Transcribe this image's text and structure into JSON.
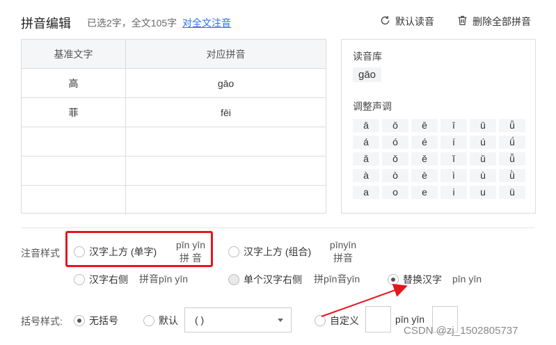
{
  "header": {
    "title": "拼音编辑",
    "selection_info": "已选2字，全文105字",
    "annotate_all_link": "对全文注音",
    "default_reading_button": "默认读音",
    "delete_all_button": "删除全部拼音"
  },
  "table": {
    "columns": [
      "基准文字",
      "对应拼音"
    ],
    "rows": [
      {
        "char": "高",
        "pinyin": "gāo"
      },
      {
        "char": "菲",
        "pinyin": "fēi"
      },
      {
        "char": "",
        "pinyin": ""
      },
      {
        "char": "",
        "pinyin": ""
      },
      {
        "char": "",
        "pinyin": ""
      }
    ]
  },
  "panel": {
    "library_label": "读音库",
    "library_item": "gāo",
    "tone_label": "调整声调",
    "tones": [
      [
        "ā",
        "ō",
        "ē",
        "ī",
        "ū",
        "ǖ"
      ],
      [
        "á",
        "ó",
        "é",
        "í",
        "ú",
        "ǘ"
      ],
      [
        "ǎ",
        "ǒ",
        "ě",
        "ǐ",
        "ǔ",
        "ǚ"
      ],
      [
        "à",
        "ò",
        "è",
        "ì",
        "ù",
        "ǜ"
      ],
      [
        "a",
        "o",
        "e",
        "i",
        "u",
        "ü"
      ]
    ]
  },
  "annotation_style": {
    "label": "注音样式",
    "options": [
      {
        "label": "汉字上方 (单字)",
        "preview_top": "pīn yīn",
        "preview_bottom": "拼  音",
        "selected": false
      },
      {
        "label": "汉字上方 (组合)",
        "preview_top": "pīnyīn",
        "preview_bottom": "拼音",
        "selected": false
      },
      {
        "label": "汉字右侧",
        "preview": "拼音pīn yīn",
        "selected": false
      },
      {
        "label": "单个汉字右侧",
        "preview": "拼pīn音yīn",
        "selected": false
      },
      {
        "label": "替换汉字",
        "preview": "pīn yīn",
        "selected": true
      }
    ]
  },
  "bracket_style": {
    "label": "括号样式:",
    "options": [
      {
        "label": "无括号",
        "selected": true
      },
      {
        "label": "默认",
        "selected": false
      },
      {
        "label": "自定义",
        "selected": false
      }
    ],
    "select_value": "( )",
    "custom_preview": "pīn yīn"
  },
  "watermark": "CSDN @zj_1502805737",
  "colors": {
    "link": "#2a6ef2",
    "highlight": "#e5161d"
  }
}
